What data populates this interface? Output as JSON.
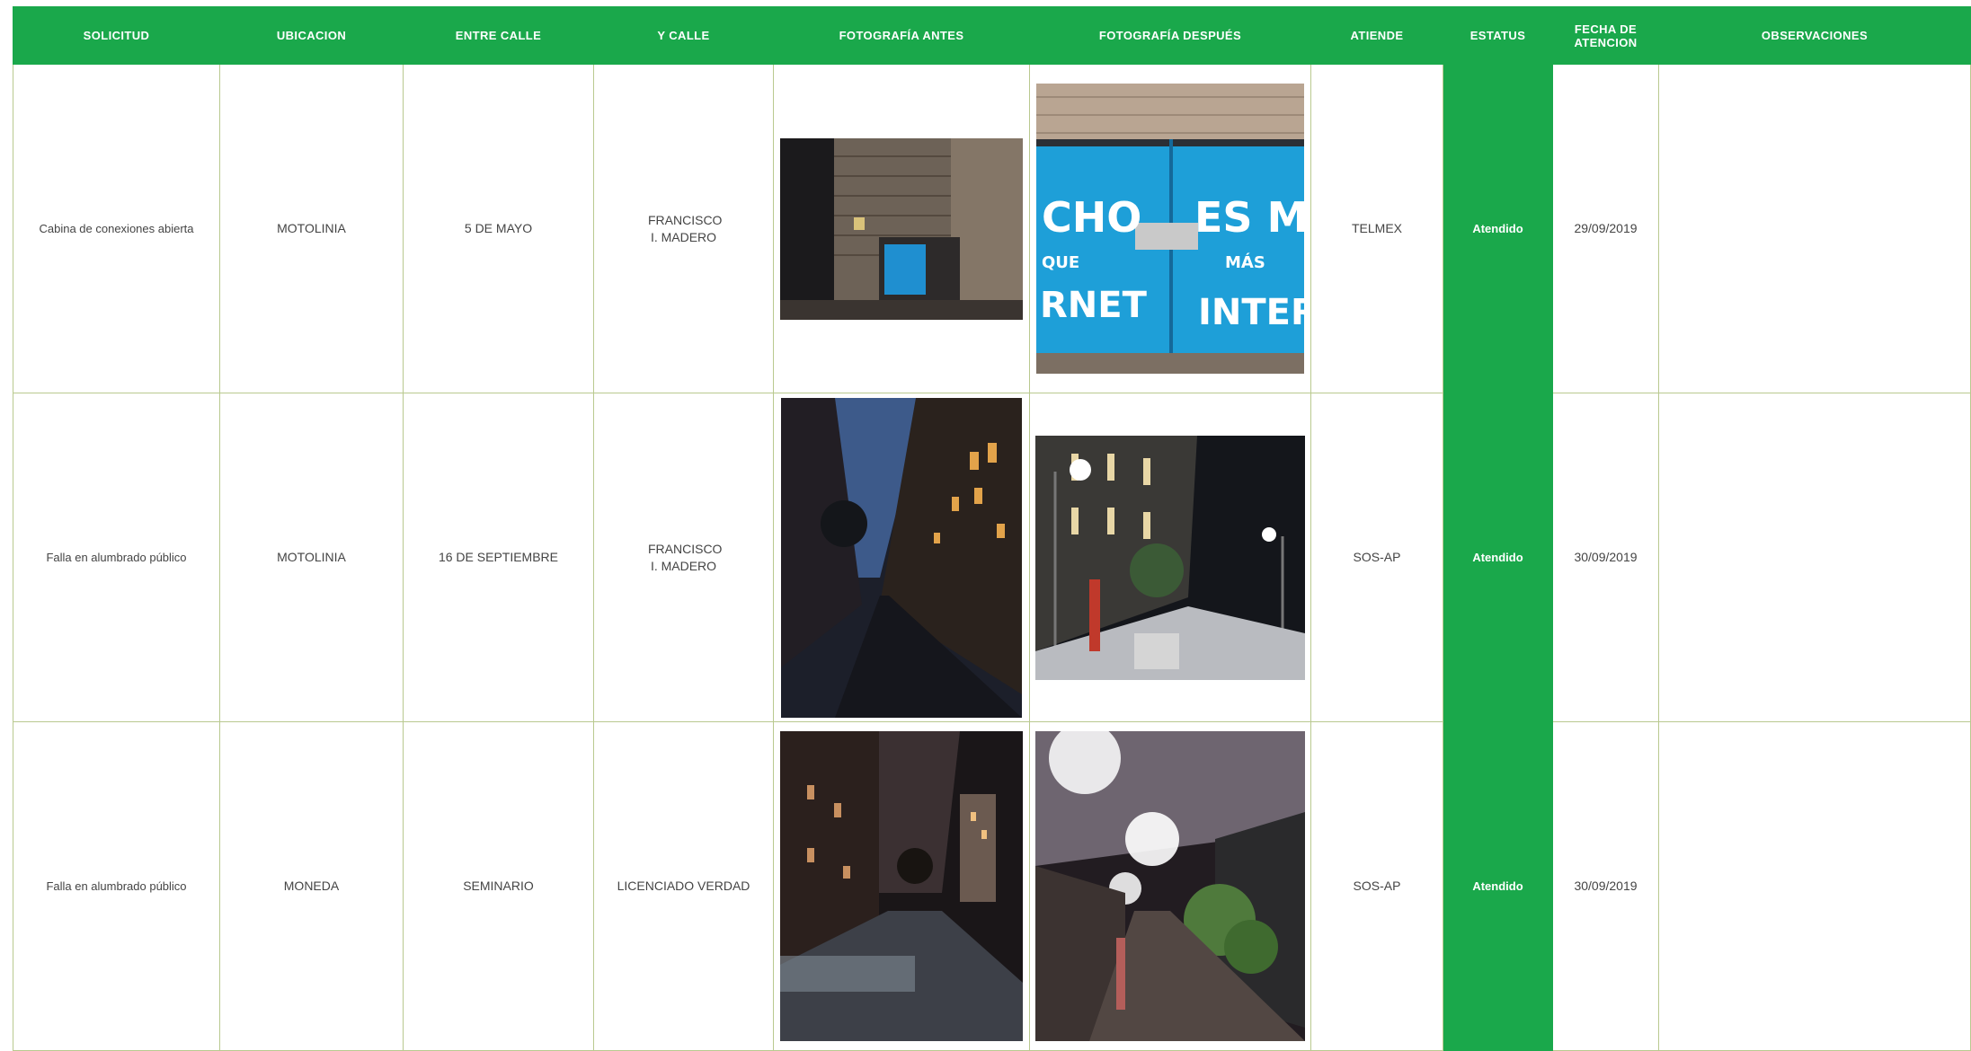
{
  "table": {
    "headers": [
      "SOLICITUD",
      "UBICACION",
      "ENTRE CALLE",
      "Y CALLE",
      "FOTOGRAFÍA ANTES",
      "FOTOGRAFÍA DESPUÉS",
      "ATIENDE",
      "ESTATUS",
      "FECHA DE ATENCION",
      "OBSERVACIONES"
    ],
    "rows": [
      {
        "solicitud": "Cabina de conexiones abierta",
        "ubicacion": "MOTOLINIA",
        "entre_calle": "5 DE MAYO",
        "y_calle": "FRANCISCO I. MADERO",
        "foto_antes": "photo-building-doorway",
        "foto_despues": "photo-blue-cabinet",
        "atiende": "TELMEX",
        "estatus": "Atendido",
        "fecha": "29/09/2019",
        "observaciones": ""
      },
      {
        "solicitud": "Falla en alumbrado público",
        "ubicacion": "MOTOLINIA",
        "entre_calle": "16 DE SEPTIEMBRE",
        "y_calle": "FRANCISCO I. MADERO",
        "foto_antes": "photo-dark-street-dusk",
        "foto_despues": "photo-lit-street-night",
        "atiende": "SOS-AP",
        "estatus": "Atendido",
        "fecha": "30/09/2019",
        "observaciones": ""
      },
      {
        "solicitud": "Falla en alumbrado público",
        "ubicacion": "MONEDA",
        "entre_calle": "SEMINARIO",
        "y_calle": "LICENCIADO VERDAD",
        "foto_antes": "photo-dark-street-cathedral",
        "foto_despues": "photo-bright-lamps-street",
        "atiende": "SOS-AP",
        "estatus": "Atendido",
        "fecha": "30/09/2019",
        "observaciones": ""
      }
    ]
  },
  "photo_text": {
    "cabinet_lines": [
      "CHO",
      "ES M",
      "QUE",
      "MÁS",
      "RNET",
      "INTER"
    ]
  },
  "colors": {
    "header_green": "#1aa84b",
    "grid_line": "#b9c98f",
    "cabinet_blue": "#1e9fd8"
  }
}
